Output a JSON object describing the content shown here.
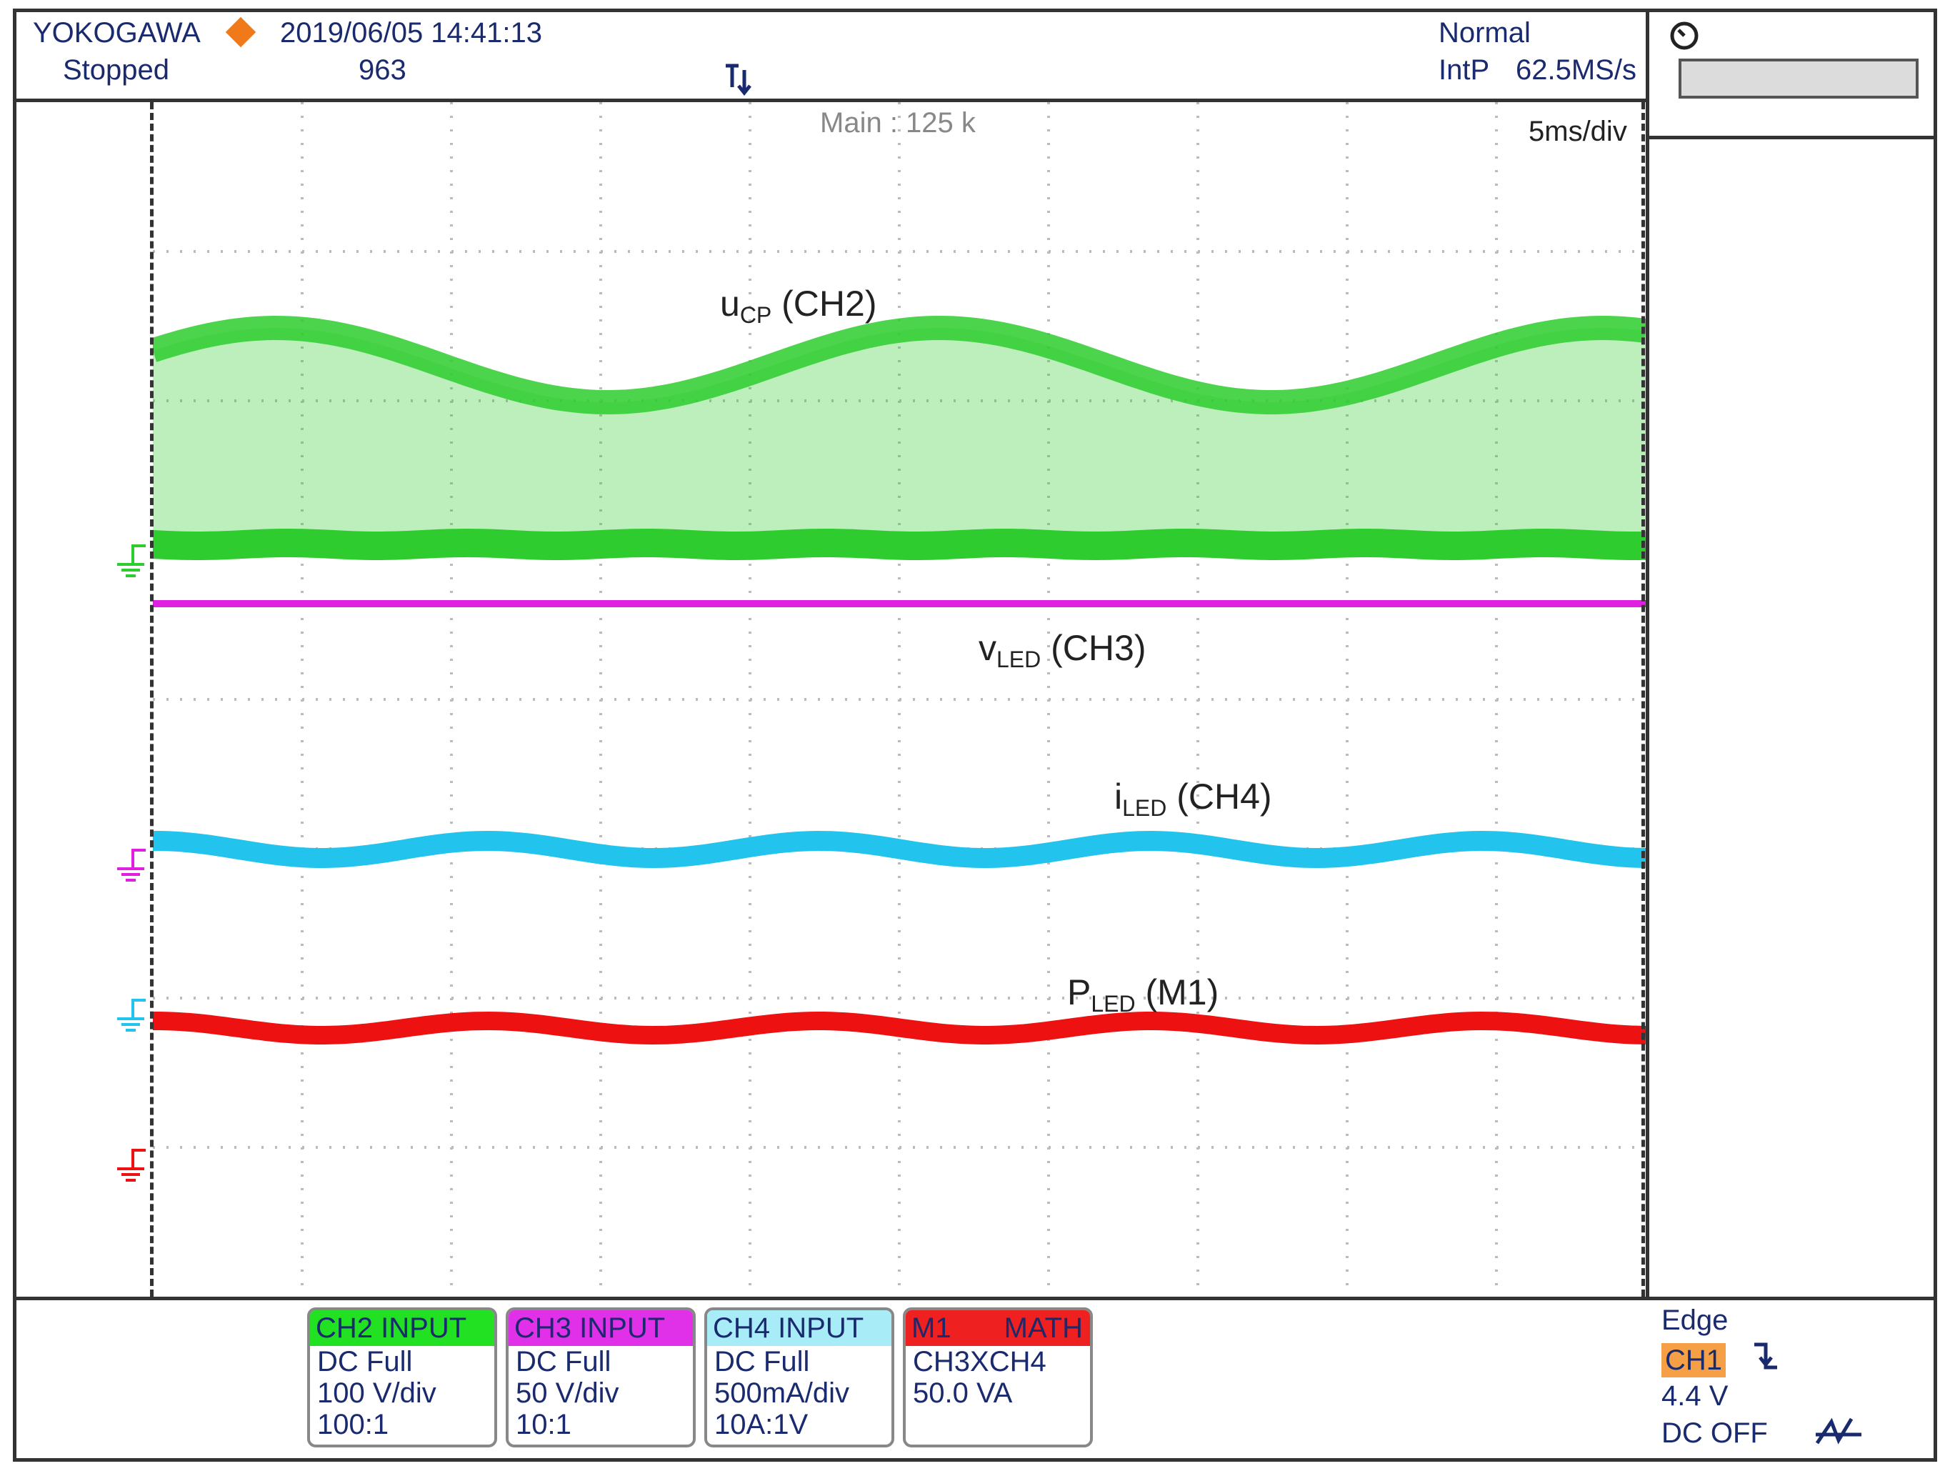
{
  "header": {
    "brand": "YOKOGAWA",
    "datetime": "2019/06/05 14:41:13",
    "status": "Stopped",
    "acq_count": "963",
    "trigger_mode": "Normal",
    "interpolation": "IntP",
    "sample_rate": "62.5MS/s"
  },
  "display": {
    "main_record": "Main : 125 k",
    "timebase": "5ms/div"
  },
  "traces": {
    "ch2": {
      "label_main": "u",
      "label_sub": "CP",
      "label_tail": " (CH2)",
      "color": "#2ecc2e"
    },
    "ch3": {
      "label_main": "v",
      "label_sub": "LED",
      "label_tail": " (CH3)",
      "color": "#e020e0"
    },
    "ch4": {
      "label_main": "i",
      "label_sub": "LED",
      "label_tail": " (CH4)",
      "color": "#22c4ee"
    },
    "m1": {
      "label_main": "P",
      "label_sub": "LED",
      "label_tail": " (M1)",
      "color": "#ee1111"
    }
  },
  "channels": [
    {
      "head": "CH2 INPUT",
      "line1": "DC Full",
      "line2": "100 V/div",
      "line3": "100:1",
      "color": "#22e022"
    },
    {
      "head": "CH3 INPUT",
      "line1": "DC Full",
      "line2": "50 V/div",
      "line3": "10:1",
      "color": "#e030e8"
    },
    {
      "head": "CH4 INPUT",
      "line1": "DC Full",
      "line2": "500mA/div",
      "line3": "10A:1V",
      "color": "#a8ecf8"
    },
    {
      "head_left": "M1",
      "head_right": "MATH",
      "line1": "CH3XCH4",
      "line2": "50.0 VA",
      "line3": "",
      "color": "#ee2020"
    }
  ],
  "trigger": {
    "type": "Edge",
    "source": "CH1",
    "level": "4.4 V",
    "coupling": "DC OFF"
  },
  "icons": {
    "run_indicator": "diamond-icon",
    "trigger_position": "trigger-marker-icon",
    "clock": "clock-icon",
    "edge_slope": "falling-edge-icon",
    "coupling": "hf-reject-icon"
  }
}
